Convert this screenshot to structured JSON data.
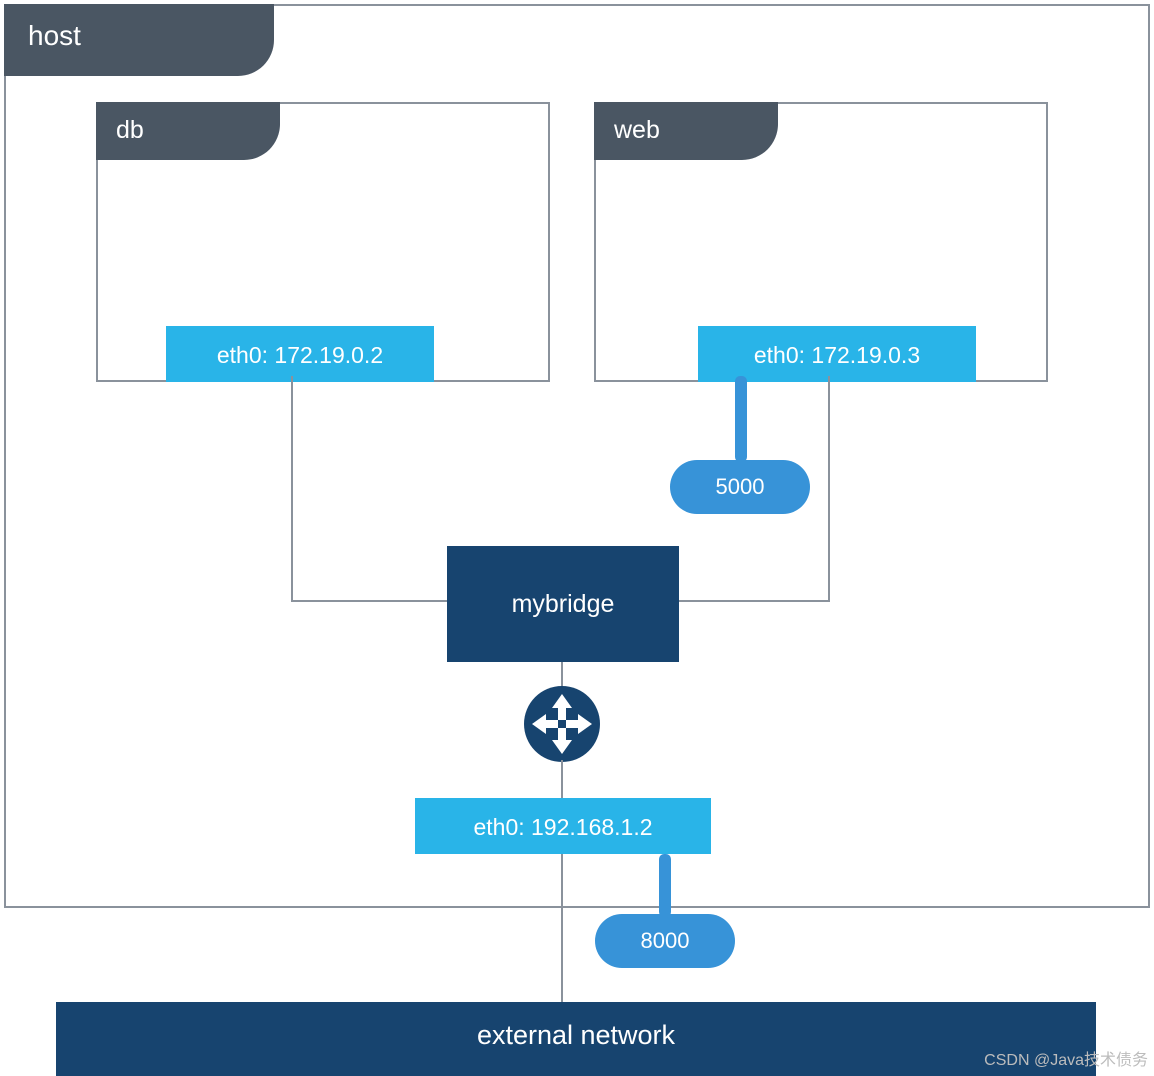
{
  "host": {
    "label": "host"
  },
  "containers": {
    "db": {
      "label": "db",
      "eth": "eth0: 172.19.0.2"
    },
    "web": {
      "label": "web",
      "eth": "eth0: 172.19.0.3",
      "port": "5000"
    }
  },
  "bridge": {
    "label": "mybridge"
  },
  "host_eth": {
    "label": "eth0: 192.168.1.2",
    "port": "8000"
  },
  "external": {
    "label": "external network"
  },
  "watermark": "CSDN @Java技术债务"
}
